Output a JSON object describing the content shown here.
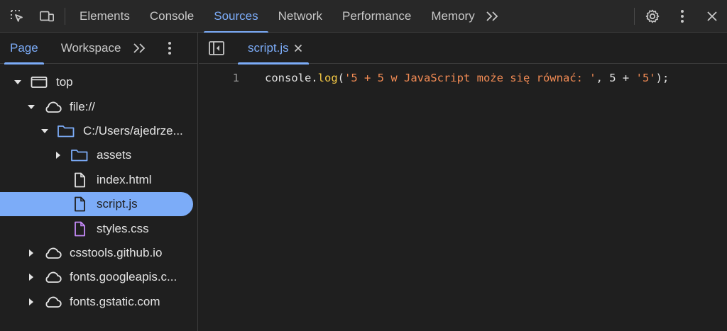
{
  "toolbar": {
    "tabs": [
      "Elements",
      "Console",
      "Sources",
      "Network",
      "Performance",
      "Memory"
    ],
    "active_tab": "Sources",
    "more_label": "»"
  },
  "navigator": {
    "tabs": [
      "Page",
      "Workspace"
    ],
    "active_tab": "Page",
    "more_label": "»",
    "tree": [
      {
        "label": "top",
        "icon": "frame-icon",
        "expanded": true
      },
      {
        "label": "file://",
        "icon": "cloud-icon",
        "expanded": true
      },
      {
        "label": "C:/Users/ajedrze...",
        "icon": "folder-icon",
        "expanded": true
      },
      {
        "label": "assets",
        "icon": "folder-icon",
        "expanded": false
      },
      {
        "label": "index.html",
        "icon": "file-icon"
      },
      {
        "label": "script.js",
        "icon": "file-icon",
        "selected": true
      },
      {
        "label": "styles.css",
        "icon": "css-file-icon"
      },
      {
        "label": "csstools.github.io",
        "icon": "cloud-icon",
        "expanded": false
      },
      {
        "label": "fonts.googleapis.c...",
        "icon": "cloud-icon",
        "expanded": false
      },
      {
        "label": "fonts.gstatic.com",
        "icon": "cloud-icon",
        "expanded": false
      }
    ]
  },
  "editor": {
    "tab_label": "script.js",
    "line_number": "1",
    "code": {
      "obj": "console.",
      "fn": "log",
      "open": "(",
      "str1": "'5 + 5 w JavaScript może się równać: '",
      "mid": ", 5 + ",
      "str2": "'5'",
      "close": ");"
    }
  },
  "colors": {
    "accent": "#7cacf8",
    "background": "#1f1f1f",
    "string": "#f28b54",
    "function": "#f5c945",
    "css_icon": "#c58af9"
  }
}
